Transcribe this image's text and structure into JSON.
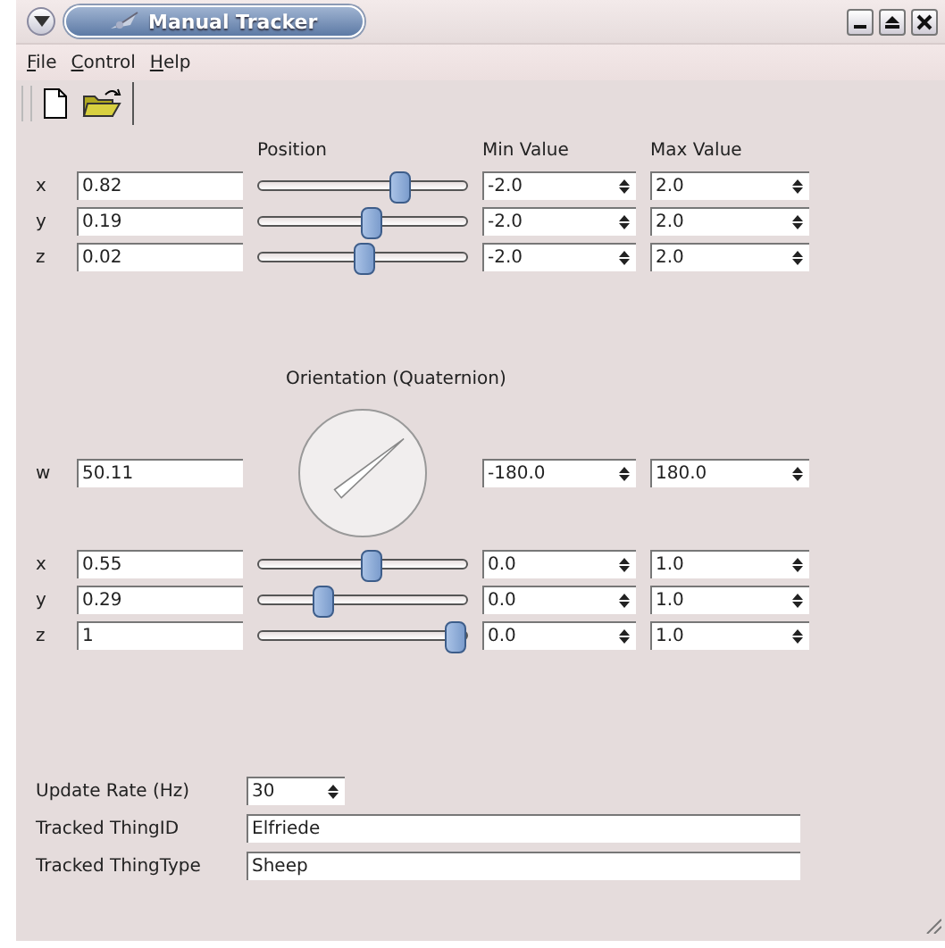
{
  "window": {
    "title": "Manual Tracker"
  },
  "menu": [
    {
      "label": "File"
    },
    {
      "label": "Control"
    },
    {
      "label": "Help"
    }
  ],
  "position": {
    "header": "Position",
    "min_header": "Min Value",
    "max_header": "Max Value",
    "rows": [
      {
        "axis": "x",
        "value": "0.82",
        "level": 0.705,
        "min": "-2.0",
        "max": "2.0"
      },
      {
        "axis": "y",
        "value": "0.19",
        "level": 0.547,
        "min": "-2.0",
        "max": "2.0"
      },
      {
        "axis": "z",
        "value": "0.02",
        "level": 0.505,
        "min": "-2.0",
        "max": "2.0"
      }
    ]
  },
  "orientation": {
    "header": "Orientation (Quaternion)",
    "w": {
      "axis": "w",
      "value": "50.11",
      "min": "-180.0",
      "max": "180.0"
    },
    "rows": [
      {
        "axis": "x",
        "value": "0.55",
        "level": 0.55,
        "min": "0.0",
        "max": "1.0"
      },
      {
        "axis": "y",
        "value": "0.29",
        "level": 0.29,
        "min": "0.0",
        "max": "1.0"
      },
      {
        "axis": "z",
        "value": "1",
        "level": 1,
        "min": "0.0",
        "max": "1.0"
      }
    ]
  },
  "settings": {
    "update_rate": {
      "label": "Update Rate (Hz)",
      "value": "30"
    },
    "fields": [
      {
        "label": "Tracked ThingID",
        "value": "Elfriede"
      },
      {
        "label": "Tracked ThingType",
        "value": "Sheep"
      }
    ]
  }
}
